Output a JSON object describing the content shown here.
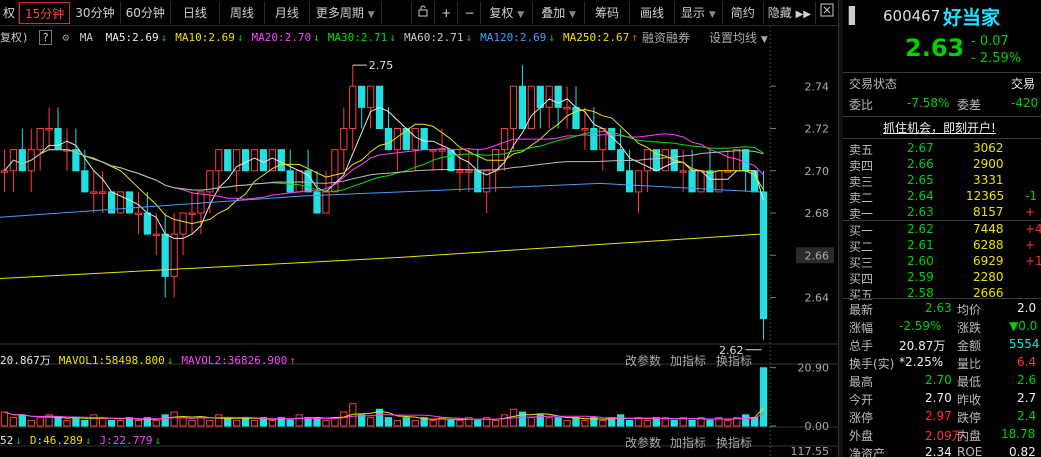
{
  "toolbar": {
    "items": [
      "权",
      "15分钟",
      "30分钟",
      "60分钟",
      "日线",
      "周线",
      "月线",
      "更多周期"
    ],
    "icons": [
      "lock-icon",
      "plus-icon",
      "minus-icon"
    ],
    "menus": [
      "复权",
      "叠加",
      "筹码",
      "画线",
      "显示",
      "简约",
      "隐藏"
    ],
    "active": "15分钟"
  },
  "ma_legend": {
    "prefix": "复权)",
    "help": "?",
    "ma_label": "MA",
    "items": [
      {
        "text": "MA5:2.69",
        "dir": "down",
        "color": "#e8e8e8"
      },
      {
        "text": "MA10:2.69",
        "dir": "down",
        "color": "#f0e000"
      },
      {
        "text": "MA20:2.70",
        "dir": "down",
        "color": "#ff40ff"
      },
      {
        "text": "MA30:2.71",
        "dir": "down",
        "color": "#00e000"
      },
      {
        "text": "MA60:2.71",
        "dir": "down",
        "color": "#cccccc"
      },
      {
        "text": "MA120:2.69",
        "dir": "down",
        "color": "#40a0ff"
      },
      {
        "text": "MA250:2.67",
        "dir": "up",
        "color": "#f0e000"
      }
    ],
    "links": [
      "融资融券",
      "设置均线"
    ]
  },
  "vol_legend": {
    "items": [
      {
        "text": "20.867万",
        "color": "#e8e8e8"
      },
      {
        "text": "MAVOL1:58498.800",
        "color": "#f0e000",
        "dir": "down"
      },
      {
        "text": "MAVOL2:36826.900",
        "color": "#ff40ff",
        "dir": "up"
      }
    ],
    "links": [
      "改参数",
      "加指标",
      "换指标"
    ]
  },
  "kdj_legend": {
    "items": [
      {
        "text": "52",
        "color": "#e8e8e8",
        "dir": "down"
      },
      {
        "text": "D:46.289",
        "color": "#f0e000",
        "dir": "down"
      },
      {
        "text": "J:22.779",
        "color": "#ff40ff",
        "dir": "down"
      }
    ],
    "links": [
      "改参数",
      "加指标",
      "换指标"
    ]
  },
  "chart_data": {
    "type": "candlestick",
    "price_axis": {
      "ticks": [
        2.74,
        2.72,
        2.7,
        2.68,
        2.66,
        2.64
      ],
      "highlight": 2.66,
      "ylim": [
        2.618,
        2.76
      ]
    },
    "annotations": [
      {
        "text": "2.75",
        "price": 2.75
      },
      {
        "text": "2.62",
        "price": 2.62
      }
    ],
    "candles": [
      [
        2.7,
        2.71,
        2.69,
        2.7
      ],
      [
        2.7,
        2.71,
        2.69,
        2.71
      ],
      [
        2.71,
        2.72,
        2.7,
        2.7
      ],
      [
        2.7,
        2.72,
        2.69,
        2.71
      ],
      [
        2.71,
        2.72,
        2.7,
        2.72
      ],
      [
        2.72,
        2.73,
        2.71,
        2.72
      ],
      [
        2.72,
        2.73,
        2.71,
        2.71
      ],
      [
        2.71,
        2.72,
        2.7,
        2.71
      ],
      [
        2.71,
        2.72,
        2.7,
        2.7
      ],
      [
        2.7,
        2.71,
        2.69,
        2.69
      ],
      [
        2.69,
        2.7,
        2.68,
        2.69
      ],
      [
        2.69,
        2.7,
        2.68,
        2.69
      ],
      [
        2.69,
        2.69,
        2.68,
        2.68
      ],
      [
        2.68,
        2.69,
        2.68,
        2.69
      ],
      [
        2.69,
        2.69,
        2.68,
        2.68
      ],
      [
        2.68,
        2.69,
        2.67,
        2.68
      ],
      [
        2.68,
        2.69,
        2.67,
        2.67
      ],
      [
        2.67,
        2.68,
        2.66,
        2.67
      ],
      [
        2.67,
        2.68,
        2.64,
        2.65
      ],
      [
        2.65,
        2.68,
        2.64,
        2.67
      ],
      [
        2.67,
        2.68,
        2.66,
        2.68
      ],
      [
        2.68,
        2.69,
        2.67,
        2.68
      ],
      [
        2.68,
        2.69,
        2.67,
        2.69
      ],
      [
        2.69,
        2.7,
        2.68,
        2.7
      ],
      [
        2.7,
        2.71,
        2.69,
        2.71
      ],
      [
        2.71,
        2.71,
        2.7,
        2.7
      ],
      [
        2.7,
        2.71,
        2.69,
        2.71
      ],
      [
        2.71,
        2.71,
        2.7,
        2.7
      ],
      [
        2.7,
        2.71,
        2.7,
        2.71
      ],
      [
        2.71,
        2.71,
        2.7,
        2.7
      ],
      [
        2.7,
        2.71,
        2.7,
        2.71
      ],
      [
        2.71,
        2.71,
        2.7,
        2.7
      ],
      [
        2.7,
        2.71,
        2.69,
        2.69
      ],
      [
        2.69,
        2.7,
        2.69,
        2.7
      ],
      [
        2.7,
        2.71,
        2.69,
        2.69
      ],
      [
        2.69,
        2.7,
        2.68,
        2.68
      ],
      [
        2.68,
        2.7,
        2.68,
        2.69
      ],
      [
        2.69,
        2.71,
        2.69,
        2.71
      ],
      [
        2.71,
        2.73,
        2.7,
        2.72
      ],
      [
        2.72,
        2.75,
        2.71,
        2.74
      ],
      [
        2.74,
        2.74,
        2.72,
        2.73
      ],
      [
        2.73,
        2.74,
        2.72,
        2.74
      ],
      [
        2.74,
        2.74,
        2.72,
        2.72
      ],
      [
        2.72,
        2.73,
        2.71,
        2.71
      ],
      [
        2.71,
        2.72,
        2.7,
        2.72
      ],
      [
        2.72,
        2.72,
        2.71,
        2.71
      ],
      [
        2.71,
        2.72,
        2.7,
        2.72
      ],
      [
        2.72,
        2.72,
        2.71,
        2.71
      ],
      [
        2.71,
        2.71,
        2.7,
        2.71
      ],
      [
        2.71,
        2.72,
        2.7,
        2.71
      ],
      [
        2.71,
        2.71,
        2.7,
        2.7
      ],
      [
        2.7,
        2.71,
        2.69,
        2.7
      ],
      [
        2.7,
        2.71,
        2.69,
        2.7
      ],
      [
        2.7,
        2.71,
        2.69,
        2.69
      ],
      [
        2.69,
        2.7,
        2.68,
        2.7
      ],
      [
        2.7,
        2.71,
        2.69,
        2.71
      ],
      [
        2.71,
        2.72,
        2.7,
        2.72
      ],
      [
        2.72,
        2.74,
        2.71,
        2.74
      ],
      [
        2.74,
        2.75,
        2.72,
        2.72
      ],
      [
        2.72,
        2.74,
        2.72,
        2.74
      ],
      [
        2.74,
        2.74,
        2.72,
        2.73
      ],
      [
        2.73,
        2.74,
        2.72,
        2.74
      ],
      [
        2.74,
        2.74,
        2.72,
        2.73
      ],
      [
        2.73,
        2.74,
        2.72,
        2.73
      ],
      [
        2.73,
        2.74,
        2.72,
        2.72
      ],
      [
        2.72,
        2.73,
        2.71,
        2.72
      ],
      [
        2.72,
        2.73,
        2.71,
        2.71
      ],
      [
        2.71,
        2.72,
        2.7,
        2.72
      ],
      [
        2.72,
        2.72,
        2.71,
        2.71
      ],
      [
        2.71,
        2.72,
        2.7,
        2.7
      ],
      [
        2.7,
        2.71,
        2.69,
        2.69
      ],
      [
        2.69,
        2.7,
        2.68,
        2.7
      ],
      [
        2.7,
        2.71,
        2.69,
        2.71
      ],
      [
        2.71,
        2.71,
        2.7,
        2.7
      ],
      [
        2.7,
        2.71,
        2.7,
        2.71
      ],
      [
        2.71,
        2.71,
        2.7,
        2.7
      ],
      [
        2.7,
        2.71,
        2.69,
        2.7
      ],
      [
        2.7,
        2.71,
        2.69,
        2.69
      ],
      [
        2.69,
        2.7,
        2.69,
        2.7
      ],
      [
        2.7,
        2.71,
        2.69,
        2.69
      ],
      [
        2.69,
        2.7,
        2.69,
        2.7
      ],
      [
        2.7,
        2.71,
        2.7,
        2.7
      ],
      [
        2.7,
        2.71,
        2.7,
        2.71
      ],
      [
        2.71,
        2.71,
        2.69,
        2.7
      ],
      [
        2.7,
        2.7,
        2.69,
        2.69
      ],
      [
        2.69,
        2.7,
        2.62,
        2.63
      ]
    ],
    "volume": {
      "ticks": [
        20.9,
        0.0
      ],
      "ylim": [
        0,
        21.5
      ],
      "values": [
        5,
        3,
        4,
        2,
        3,
        4,
        3,
        2,
        3,
        2,
        4,
        3,
        2,
        2,
        3,
        2,
        3,
        2,
        4,
        5,
        3,
        2,
        3,
        2,
        4,
        3,
        2,
        3,
        2,
        3,
        2,
        3,
        2,
        4,
        3,
        3,
        2,
        3,
        5,
        8,
        4,
        3,
        6,
        3,
        2,
        3,
        2,
        3,
        2,
        3,
        2,
        2,
        3,
        2,
        3,
        2,
        4,
        6,
        5,
        3,
        4,
        3,
        3,
        2,
        3,
        2,
        3,
        2,
        3,
        4,
        2,
        3,
        2,
        3,
        3,
        2,
        3,
        2,
        3,
        2,
        3,
        2,
        3,
        4,
        3,
        20.87
      ]
    },
    "kdj_axis": {
      "ticks": [
        117.55
      ]
    }
  },
  "panel": {
    "code": "600467",
    "name": "好当家",
    "price": "2.63",
    "change": "- 0.07",
    "change_pct": "- 2.59%",
    "status_label": "交易状态",
    "status_value": "交易",
    "weibi_label": "委比",
    "weibi_value": "-7.58%",
    "weicha_label": "委差",
    "weicha_value": "-420",
    "promo": "抓住机会，即刻开户!",
    "asks": [
      {
        "label": "卖五",
        "price": "2.67",
        "vol": "3062",
        "diff": ""
      },
      {
        "label": "卖四",
        "price": "2.66",
        "vol": "2900",
        "diff": ""
      },
      {
        "label": "卖三",
        "price": "2.65",
        "vol": "3331",
        "diff": ""
      },
      {
        "label": "卖二",
        "price": "2.64",
        "vol": "12365",
        "diff": "-1"
      },
      {
        "label": "卖一",
        "price": "2.63",
        "vol": "8157",
        "diff": "+"
      }
    ],
    "bids": [
      {
        "label": "买一",
        "price": "2.62",
        "vol": "7448",
        "diff": "+4"
      },
      {
        "label": "买二",
        "price": "2.61",
        "vol": "6288",
        "diff": "+"
      },
      {
        "label": "买三",
        "price": "2.60",
        "vol": "6929",
        "diff": "+1"
      },
      {
        "label": "买四",
        "price": "2.59",
        "vol": "2280",
        "diff": ""
      },
      {
        "label": "买五",
        "price": "2.58",
        "vol": "2666",
        "diff": ""
      }
    ],
    "stats": [
      {
        "l1": "最新",
        "v1": "2.63",
        "c1": "green",
        "l2": "均价",
        "v2": "2.0",
        "c2": "white"
      },
      {
        "l1": "涨幅",
        "v1": "-2.59%",
        "c1": "green",
        "l2": "涨跌",
        "v2": "▼0.0",
        "c2": "green"
      },
      {
        "l1": "总手",
        "v1": "20.87万",
        "c1": "white",
        "l2": "金额",
        "v2": "5554",
        "c2": "cyan"
      },
      {
        "l1": "换手(实)",
        "v1": "*2.25%",
        "c1": "white",
        "l2": "量比",
        "v2": "6.4",
        "c2": "red"
      },
      {
        "l1": "最高",
        "v1": "2.70",
        "c1": "green",
        "l2": "最低",
        "v2": "2.6",
        "c2": "green"
      },
      {
        "l1": "今开",
        "v1": "2.70",
        "c1": "white",
        "l2": "昨收",
        "v2": "2.7",
        "c2": "white"
      },
      {
        "l1": "涨停",
        "v1": "2.97",
        "c1": "red",
        "l2": "跌停",
        "v2": "2.4",
        "c2": "green"
      },
      {
        "l1": "外盘",
        "v1": "2.09万",
        "c1": "red",
        "l2": "内盘",
        "v2": "18.78",
        "c2": "green"
      },
      {
        "l1": "净资产",
        "v1": "2.34",
        "c1": "white",
        "l2": "ROE",
        "v2": "0.82",
        "c2": "white"
      }
    ]
  }
}
